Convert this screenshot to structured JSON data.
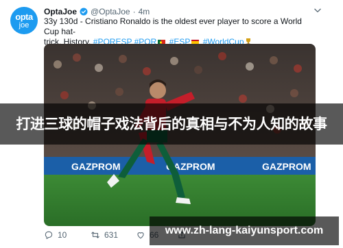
{
  "tweet": {
    "avatar": {
      "line1": "opta",
      "line2": "joe"
    },
    "display_name": "OptaJoe",
    "handle": "@OptaJoe",
    "separator": "·",
    "time": "4m",
    "text_line1": "33y 130d - Cristiano Ronaldo is the oldest ever player to score a World Cup hat-",
    "text_line2_prefix": "trick. History.",
    "hashtags": [
      "#PORESP",
      "#POR",
      "#ESP",
      "#WorldCup"
    ],
    "banner_text": "打进三球的帽子戏法背后的真相与不为人知的故事",
    "ad_boards": [
      "GAZPROM",
      "GAZPROM",
      "GAZPROM"
    ],
    "actions": {
      "reply_count": "10",
      "retweet_count": "631",
      "like_count": "66"
    }
  },
  "watermark": "www.zh-lang-kaiyunsport.com",
  "colors": {
    "accent": "#1d9bf0",
    "text": "#0f1419",
    "muted": "#536471",
    "pitch": "#2f7a2c",
    "board": "#1b5fa8"
  }
}
